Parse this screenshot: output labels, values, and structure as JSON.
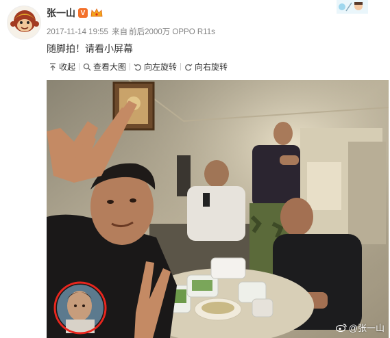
{
  "post": {
    "username": "张一山",
    "verified_badge": "V",
    "timestamp": "2017-11-14 19:55",
    "source_prefix": "来自",
    "source": "前后2000万 OPPO R11s",
    "text": "随脚拍！请看小屏幕"
  },
  "toolbar": {
    "collapse_label": "收起",
    "view_large_label": "查看大图",
    "rotate_left_label": "向左旋转",
    "rotate_right_label": "向右旋转"
  },
  "photo": {
    "watermark_text": "@张一山"
  },
  "colors": {
    "badge": "#f3702a",
    "meta_text": "#808080",
    "highlight_circle": "#e8261e"
  },
  "icons": [
    "avatar",
    "verified-icon",
    "crown-icon",
    "collapse-icon",
    "zoom-icon",
    "rotate-left-icon",
    "rotate-right-icon",
    "weibo-logo-icon"
  ]
}
